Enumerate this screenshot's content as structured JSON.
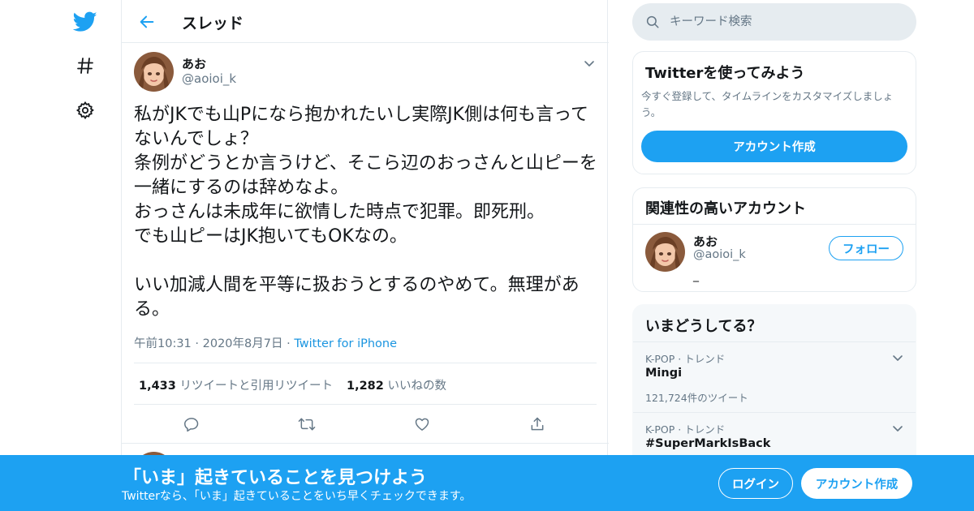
{
  "nav": {
    "icons": [
      "twitter-logo-icon",
      "hashtag-icon",
      "gear-icon"
    ]
  },
  "header": {
    "title": "スレッド",
    "back_icon": "arrow-left-icon"
  },
  "tweet": {
    "author_name": "あお",
    "author_handle": "@aoioi_k",
    "body": "私がJKでも山Pになら抱かれたいし実際JK側は何も言ってないんでしょ？\n条例がどうとか言うけど、そこら辺のおっさんと山ピーを一緒にするのは辞めなよ。\nおっさんは未成年に欲情した時点で犯罪。即死刑。\nでも山ピーはJK抱いてもOKなの。\n\nいい加減人間を平等に扱おうとするのやめて。無理がある。",
    "time": "午前10:31",
    "date": "2020年8月7日",
    "separator": "·",
    "source": "Twitter for iPhone",
    "retweet_count": "1,433",
    "retweet_label": "リツイートと引用リツイート",
    "like_count": "1,282",
    "like_label": "いいねの数",
    "actions": [
      "reply-icon",
      "retweet-icon",
      "like-icon",
      "share-icon"
    ]
  },
  "search": {
    "placeholder": "キーワード検索"
  },
  "signup_card": {
    "title": "Twitterを使ってみよう",
    "description": "今すぐ登録して、タイムラインをカスタマイズしましょう。",
    "button": "アカウント作成"
  },
  "related_card": {
    "title": "関連性の高いアカウント",
    "account": {
      "name": "あお",
      "handle": "@aoioi_k",
      "bio": "_",
      "follow_label": "フォロー"
    }
  },
  "trends_card": {
    "title": "いまどうしてる？",
    "items": [
      {
        "category": "K-POP · トレンド",
        "name": "Mingi",
        "count": "121,724件のツイート"
      },
      {
        "category": "K-POP · トレンド",
        "name": "#SuperMarkIsBack",
        "count": ""
      }
    ]
  },
  "banner": {
    "title": "「いま」起きていることを見つけよう",
    "subtitle": "Twitterなら、「いま」起きていることをいち早くチェックできます。",
    "login": "ログイン",
    "signup": "アカウント作成"
  },
  "colors": {
    "accent": "#1da1f2",
    "link": "#1b95e0",
    "muted": "#657786",
    "border": "#e6ecf0",
    "text": "#14171a"
  }
}
